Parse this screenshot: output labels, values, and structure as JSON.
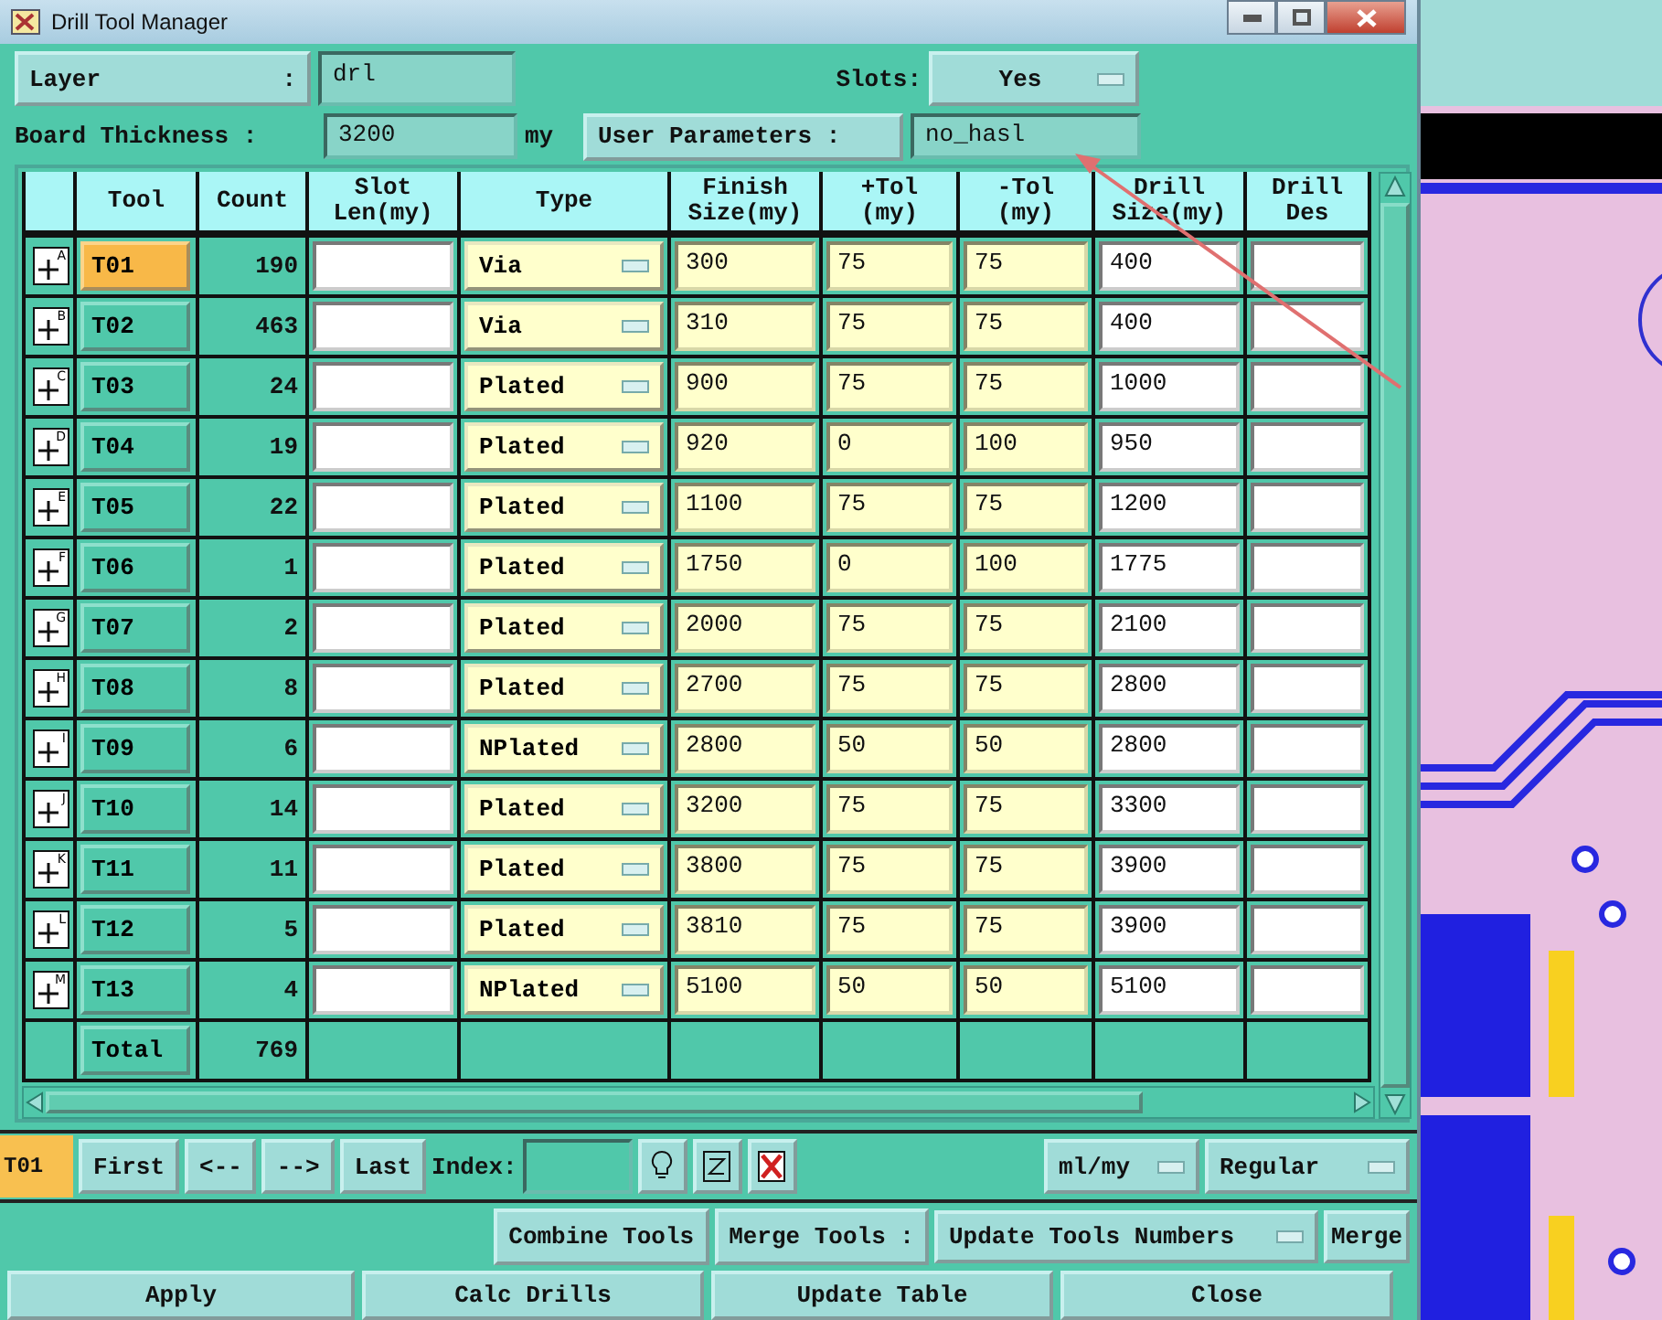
{
  "window": {
    "title": "Drill Tool Manager"
  },
  "layer": {
    "label": "Layer",
    "colon": ":",
    "value": "drl"
  },
  "slots": {
    "label": "Slots:",
    "value": "Yes"
  },
  "board_thickness": {
    "label": "Board Thickness :",
    "value": "3200",
    "unit": "my"
  },
  "user_parameters": {
    "label": "User Parameters :",
    "value": "no_hasl"
  },
  "table": {
    "columns": [
      "Tool",
      "Count",
      "Slot\nLen(my)",
      "Type",
      "Finish\nSize(my)",
      "+Tol\n(my)",
      "-Tol\n(my)",
      "Drill\nSize(my)",
      "Drill\nDes"
    ],
    "rows": [
      {
        "marker": "A",
        "tool": "T01",
        "selected": true,
        "count": "190",
        "type": "Via",
        "finish": "300",
        "plus_tol": "75",
        "minus_tol": "75",
        "drill": "400"
      },
      {
        "marker": "B",
        "tool": "T02",
        "selected": false,
        "count": "463",
        "type": "Via",
        "finish": "310",
        "plus_tol": "75",
        "minus_tol": "75",
        "drill": "400"
      },
      {
        "marker": "C",
        "tool": "T03",
        "selected": false,
        "count": "24",
        "type": "Plated",
        "finish": "900",
        "plus_tol": "75",
        "minus_tol": "75",
        "drill": "1000"
      },
      {
        "marker": "D",
        "tool": "T04",
        "selected": false,
        "count": "19",
        "type": "Plated",
        "finish": "920",
        "plus_tol": "0",
        "minus_tol": "100",
        "drill": "950"
      },
      {
        "marker": "E",
        "tool": "T05",
        "selected": false,
        "count": "22",
        "type": "Plated",
        "finish": "1100",
        "plus_tol": "75",
        "minus_tol": "75",
        "drill": "1200"
      },
      {
        "marker": "F",
        "tool": "T06",
        "selected": false,
        "count": "1",
        "type": "Plated",
        "finish": "1750",
        "plus_tol": "0",
        "minus_tol": "100",
        "drill": "1775"
      },
      {
        "marker": "G",
        "tool": "T07",
        "selected": false,
        "count": "2",
        "type": "Plated",
        "finish": "2000",
        "plus_tol": "75",
        "minus_tol": "75",
        "drill": "2100"
      },
      {
        "marker": "H",
        "tool": "T08",
        "selected": false,
        "count": "8",
        "type": "Plated",
        "finish": "2700",
        "plus_tol": "75",
        "minus_tol": "75",
        "drill": "2800"
      },
      {
        "marker": "I",
        "tool": "T09",
        "selected": false,
        "count": "6",
        "type": "NPlated",
        "finish": "2800",
        "plus_tol": "50",
        "minus_tol": "50",
        "drill": "2800"
      },
      {
        "marker": "J",
        "tool": "T10",
        "selected": false,
        "count": "14",
        "type": "Plated",
        "finish": "3200",
        "plus_tol": "75",
        "minus_tol": "75",
        "drill": "3300"
      },
      {
        "marker": "K",
        "tool": "T11",
        "selected": false,
        "count": "11",
        "type": "Plated",
        "finish": "3800",
        "plus_tol": "75",
        "minus_tol": "75",
        "drill": "3900"
      },
      {
        "marker": "L",
        "tool": "T12",
        "selected": false,
        "count": "5",
        "type": "Plated",
        "finish": "3810",
        "plus_tol": "75",
        "minus_tol": "75",
        "drill": "3900"
      },
      {
        "marker": "M",
        "tool": "T13",
        "selected": false,
        "count": "4",
        "type": "NPlated",
        "finish": "5100",
        "plus_tol": "50",
        "minus_tol": "50",
        "drill": "5100"
      }
    ],
    "total": {
      "label": "Total",
      "count": "769"
    }
  },
  "navigation": {
    "current": "T01",
    "buttons": [
      "First",
      "<--",
      "-->",
      "Last"
    ],
    "index_label": "Index:"
  },
  "unit_select": "ml/my",
  "mode_select": "Regular",
  "combine_button": "Combine Tools",
  "merge_label": "Merge Tools :",
  "merge_select": "Update Tools Numbers",
  "merge_button": "Merge",
  "actions": [
    "Apply",
    "Calc Drills",
    "Update Table",
    "Close"
  ]
}
